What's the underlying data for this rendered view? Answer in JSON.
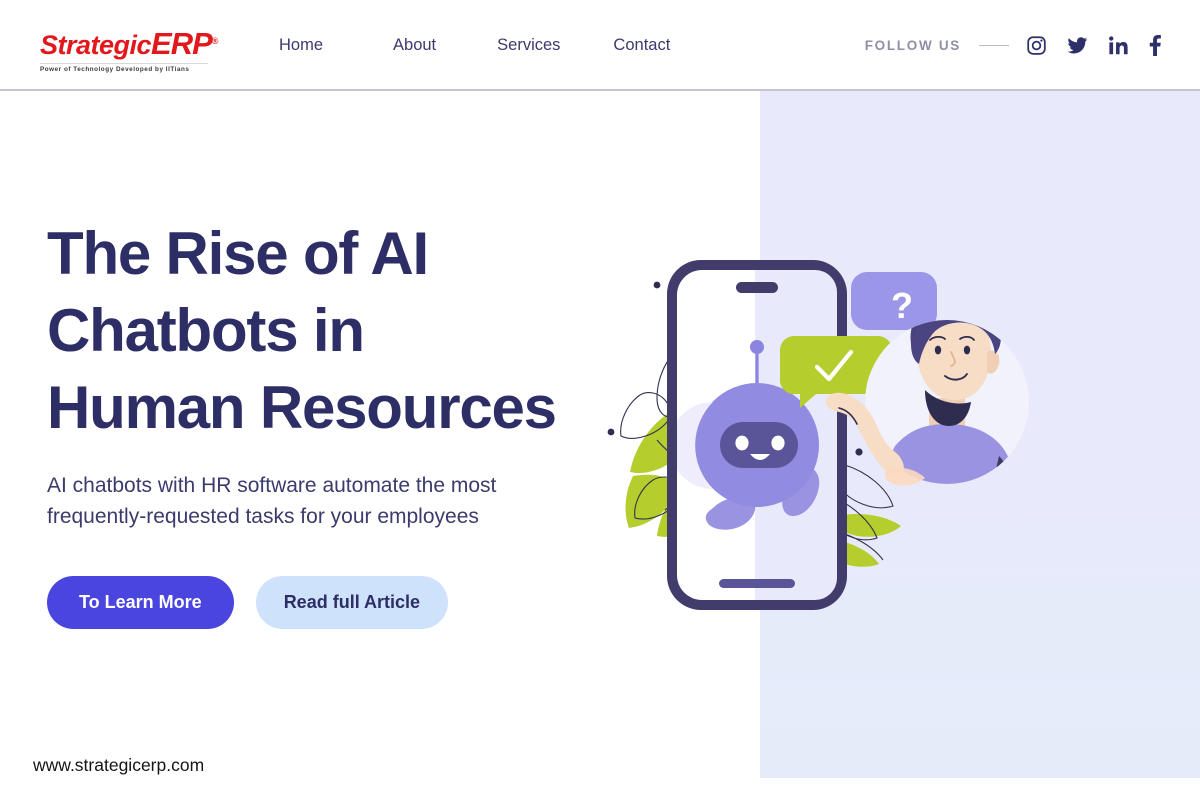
{
  "brand": {
    "logo_text_1": "Strategic",
    "logo_text_2": "ERP",
    "logo_registered": "®",
    "logo_tagline": "Power of Technology Developed by IITians",
    "logo_color": "#e2181d"
  },
  "nav": {
    "items": [
      {
        "label": "Home"
      },
      {
        "label": "About"
      },
      {
        "label": "Services"
      },
      {
        "label": "Contact"
      }
    ],
    "text_color": "#3a3a6e"
  },
  "social": {
    "label": "FOLLOW US",
    "label_color": "#8f8fa6",
    "icon_color": "#2f2f6b",
    "items": [
      {
        "name": "instagram-icon",
        "title": "Instagram"
      },
      {
        "name": "twitter-icon",
        "title": "Twitter"
      },
      {
        "name": "linkedin-icon",
        "title": "LinkedIn"
      },
      {
        "name": "facebook-icon",
        "title": "Facebook"
      }
    ]
  },
  "hero": {
    "title_line_1": "The Rise of AI",
    "title_line_2": "Chatbots in",
    "title_line_3": "Human Resources",
    "title_color": "#2e2e66",
    "subtitle_line_1": "AI chatbots with HR software automate the most",
    "subtitle_line_2": "frequently-requested tasks for your employees",
    "primary_button": "To Learn More",
    "secondary_button": "Read full Article",
    "primary_button_color": "#4b45e0",
    "secondary_button_color": "#cfe2fb"
  },
  "footer": {
    "website": "www.strategicerp.com"
  },
  "illustration": {
    "panel_color": "#e8e9fb",
    "phone_frame_color": "#413c6b",
    "robot_color": "#8b84e0",
    "robot_face_color": "#5a5599",
    "bubble_question_color": "#9b96e8",
    "bubble_question_text": "?",
    "bubble_check_color": "#b5ce2e",
    "bubble_check_glyph": "check",
    "leaf_color": "#b5ce2e",
    "person_shirt_color": "#9a93e2",
    "person_hair_color": "#4a4480",
    "person_skin_color": "#f7ddc6"
  }
}
